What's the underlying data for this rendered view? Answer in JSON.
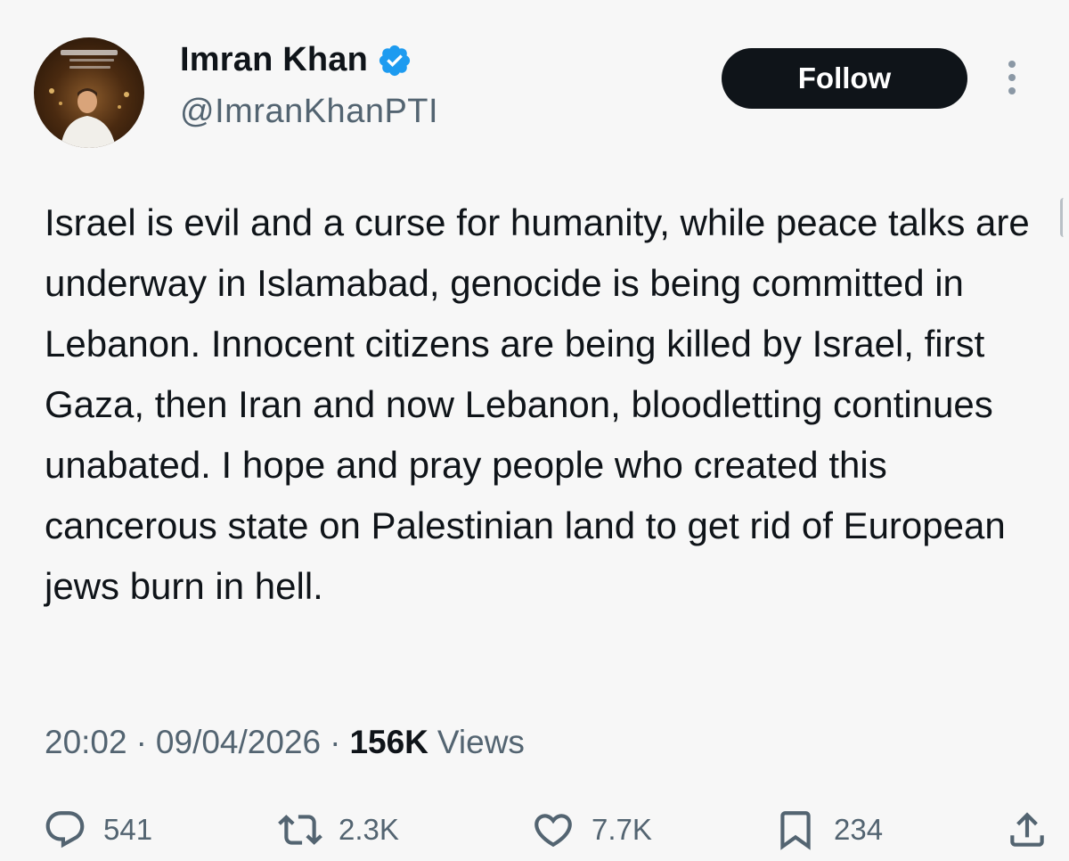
{
  "user": {
    "name": "Imran Khan",
    "handle": "@ImranKhanPTI"
  },
  "follow_label": "Follow",
  "tweet": {
    "text": "Israel is evil and a curse for humanity, while peace talks are underway in Islamabad, genocide is being committed in Lebanon. Innocent citizens are being killed by Israel, first Gaza, then Iran and now Lebanon, bloodletting continues unabated. I hope and pray people who created this cancerous state on Palestinian land to get rid of European jews burn in hell."
  },
  "meta": {
    "time": "20:02",
    "date": "09/04/2026",
    "views_count": "156K",
    "views_label": "Views",
    "separator": "·"
  },
  "actions": {
    "replies": "541",
    "reposts": "2.3K",
    "likes": "7.7K",
    "bookmarks": "234"
  },
  "colors": {
    "text": "#0f1419",
    "muted": "#536471",
    "verified": "#1d9bf0",
    "button": "#0f1419",
    "background": "#f7f7f7"
  },
  "icons": [
    "verified-badge-icon",
    "more-options-icon",
    "reply-icon",
    "retweet-icon",
    "like-icon",
    "bookmark-icon",
    "share-icon"
  ]
}
